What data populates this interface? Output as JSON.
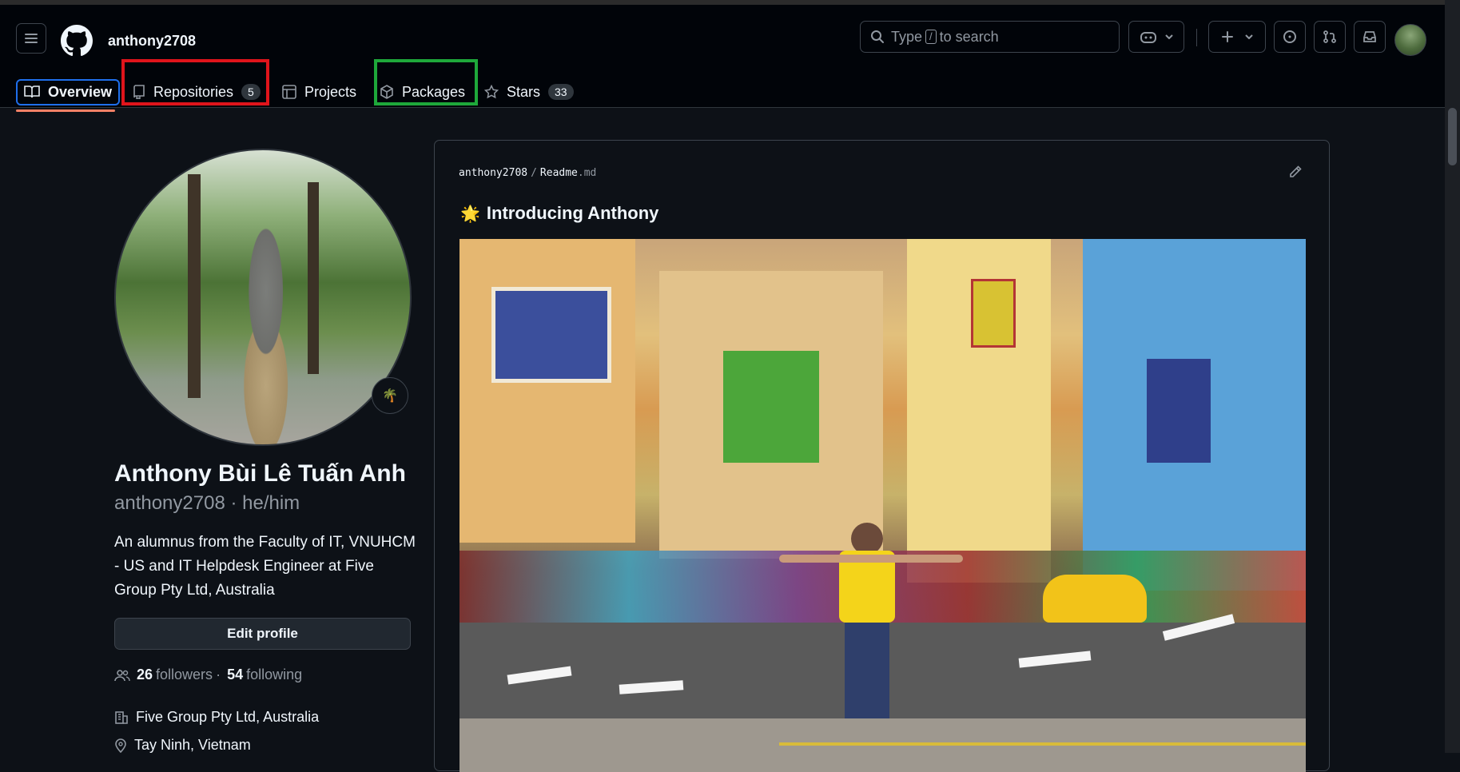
{
  "header": {
    "username": "anthony2708",
    "search": {
      "prefix": "Type",
      "key": "/",
      "suffix": "to search"
    }
  },
  "tabs": [
    {
      "label": "Overview",
      "icon": "book-icon"
    },
    {
      "label": "Repositories",
      "count": "5",
      "icon": "repo-icon"
    },
    {
      "label": "Projects",
      "icon": "table-icon"
    },
    {
      "label": "Packages",
      "icon": "package-icon"
    },
    {
      "label": "Stars",
      "count": "33",
      "icon": "star-icon"
    }
  ],
  "profile": {
    "name": "Anthony Bùi Lê Tuấn Anh",
    "handle": "anthony2708 · he/him",
    "status_emoji": "🌴",
    "bio": "An alumnus from the Faculty of IT, VNUHCM - US and IT Helpdesk Engineer at Five Group Pty Ltd, Australia",
    "edit_label": "Edit profile",
    "followers": "26",
    "followers_label": "followers",
    "dot": "·",
    "following": "54",
    "following_label": "following",
    "company": "Five Group Pty Ltd, Australia",
    "location": "Tay Ninh, Vietnam"
  },
  "readme": {
    "owner": "anthony2708",
    "separator": "/",
    "file": "Readme",
    "ext": ".md",
    "title_emoji": "🌟",
    "title": "Introducing Anthony"
  },
  "colors": {
    "background": "#0d1117",
    "header": "#010409",
    "accent_underline": "#f78166",
    "highlight_red": "#e0141b",
    "highlight_green": "#1ea83a"
  }
}
